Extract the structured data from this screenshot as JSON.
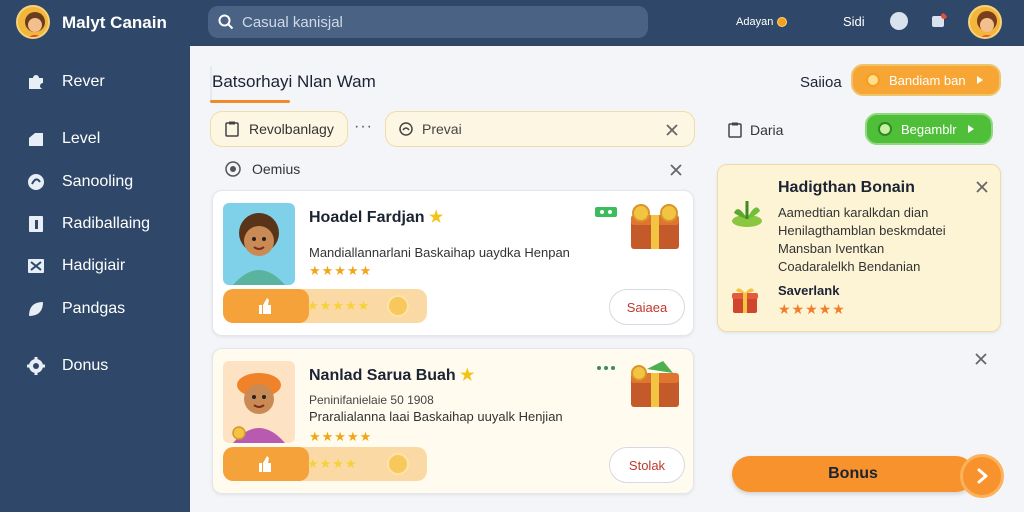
{
  "app": {
    "name": "Malyt Canain"
  },
  "search": {
    "placeholder": "Casual kanisjal"
  },
  "topbar": {
    "pill_label": "Adayan",
    "status_text": "Sidi"
  },
  "sidebar": {
    "items": [
      {
        "label": "Rever",
        "icon": "puzzle-icon"
      },
      {
        "label": "Level",
        "icon": "level-icon"
      },
      {
        "label": "Sanooling",
        "icon": "swirl-icon"
      },
      {
        "label": "Radiballaing",
        "icon": "document-icon"
      },
      {
        "label": "Hadigiair",
        "icon": "grid-x-icon"
      },
      {
        "label": "Pandgas",
        "icon": "leaf-icon"
      },
      {
        "label": "Donus",
        "icon": "gear-icon"
      }
    ]
  },
  "header": {
    "title": "Batsorhayi Nlan Wam",
    "sort_label": "Saiioa",
    "action_button": "Bandiam ban"
  },
  "filters": {
    "chip_label": "Revolbanlagy",
    "chip_more": "···",
    "input_placeholder": "Prevai",
    "dataset_label": "Daria",
    "green_button": "Begamblr"
  },
  "category": {
    "label": "Oemius"
  },
  "cards": [
    {
      "title": "Hoadel Fardjan",
      "subtitle": "",
      "description": "Mandiallannarlani Baskaihap uaydka Henpan",
      "rating": "★★★★★",
      "progress_stars": "★★★★★",
      "progress": 0.42,
      "button": "Saiaea"
    },
    {
      "title": "Nanlad Sarua Buah",
      "subtitle": "Peninifanielaie 50 1908",
      "description": "Praralialanna laai Baskaihap uuyalk Henjian",
      "rating": "★★★★★",
      "progress_stars": "★★★★",
      "progress": 0.42,
      "button": "Stolak"
    }
  ],
  "panel": {
    "title": "Hadigthan Bonain",
    "lines": [
      "Aamedtian karalkdan dian",
      "Henilagthamblan beskmdatei",
      "Mansban Iventkan",
      "Coadaralelkh Bendanian"
    ],
    "sub": "Saverlank",
    "rating": "★★★★★"
  },
  "bonus": {
    "label": "Bonus"
  },
  "colors": {
    "navy": "#2f4869",
    "orange": "#f7a535",
    "green": "#4fbf3a",
    "cream": "#fdf4d6"
  }
}
